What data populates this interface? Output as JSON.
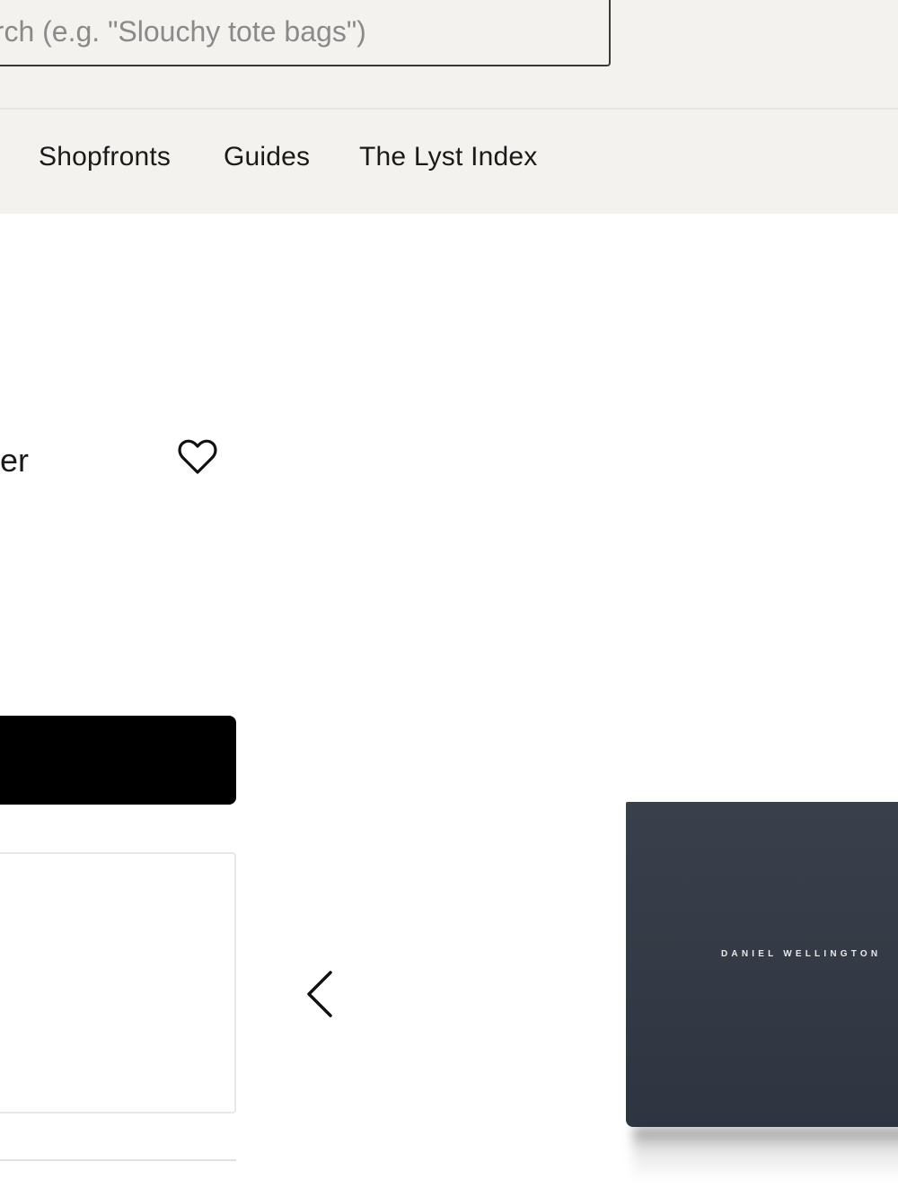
{
  "header": {
    "search": {
      "placeholder": "arch (e.g. \"Slouchy tote bags\")"
    },
    "nav": [
      "Shopfronts",
      "Guides",
      "The Lyst Index"
    ]
  },
  "product": {
    "name_fragment": "er",
    "wishlist_icon": "heart-outline-icon",
    "cta_label": "",
    "brand_print": "DANIEL WELLINGTON"
  },
  "carousel": {
    "prev_icon": "chevron-left-icon"
  },
  "colors": {
    "header_bg": "#f3f2ef",
    "button_bg": "#000000",
    "box_color": "#373d48"
  }
}
